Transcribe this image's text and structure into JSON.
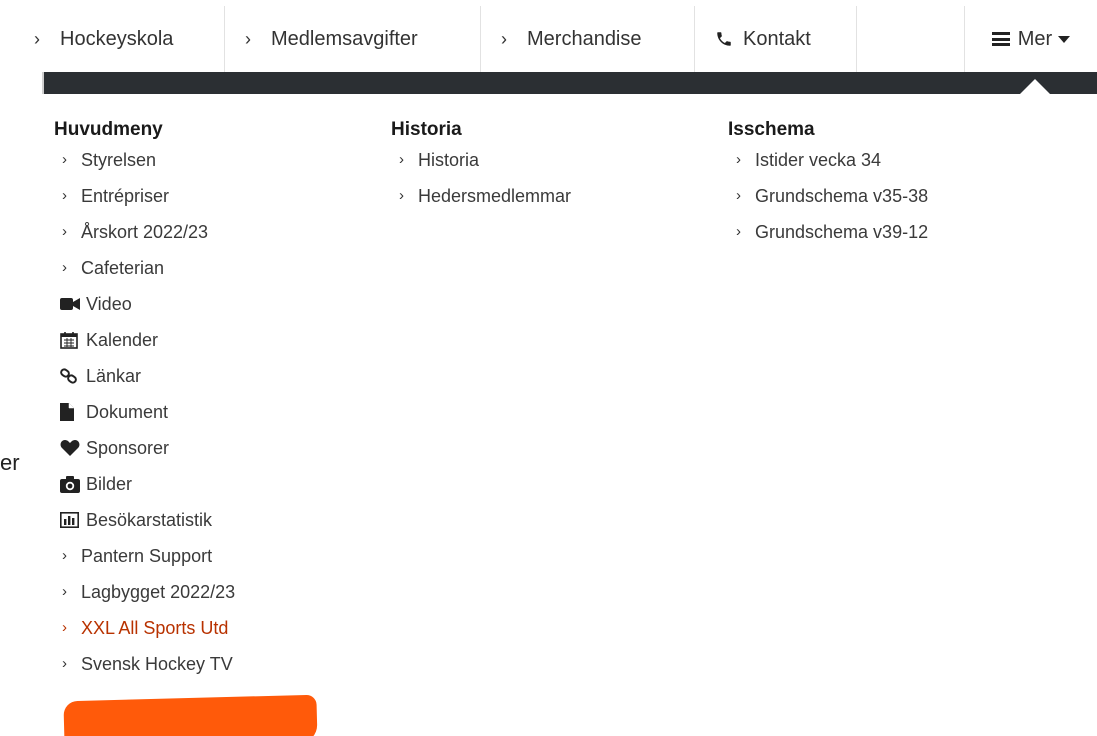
{
  "background": {
    "fragment_text": "er"
  },
  "topnav": {
    "items": [
      {
        "label": "Hockeyskola",
        "icon": "chevron-right-icon"
      },
      {
        "label": "Medlemsavgifter",
        "icon": "chevron-right-icon"
      },
      {
        "label": "Merchandise",
        "icon": "chevron-right-icon"
      },
      {
        "label": "Kontakt",
        "icon": "phone-icon"
      }
    ],
    "more": {
      "label": "Mer",
      "icon": "hamburger-icon",
      "caret": "caret-down-icon"
    }
  },
  "colors": {
    "highlight": "#ff5a0a",
    "band": "#2b2f33",
    "text": "#3a3a3a"
  },
  "mega_menu": {
    "columns": [
      {
        "title": "Huvudmeny",
        "items": [
          {
            "label": "Styrelsen",
            "icon": "chevron-right-icon"
          },
          {
            "label": "Entrépriser",
            "icon": "chevron-right-icon"
          },
          {
            "label": "Årskort 2022/23",
            "icon": "chevron-right-icon"
          },
          {
            "label": "Cafeterian",
            "icon": "chevron-right-icon"
          },
          {
            "label": "Video",
            "icon": "video-camera-icon"
          },
          {
            "label": "Kalender",
            "icon": "calendar-icon"
          },
          {
            "label": "Länkar",
            "icon": "link-icon"
          },
          {
            "label": "Dokument",
            "icon": "document-icon"
          },
          {
            "label": "Sponsorer",
            "icon": "heart-icon"
          },
          {
            "label": "Bilder",
            "icon": "camera-icon"
          },
          {
            "label": "Besökarstatistik",
            "icon": "bar-chart-icon"
          },
          {
            "label": "Pantern Support",
            "icon": "chevron-right-icon"
          },
          {
            "label": "Lagbygget 2022/23",
            "icon": "chevron-right-icon"
          },
          {
            "label": "XXL All Sports Utd",
            "icon": "chevron-right-icon",
            "highlighted": true
          },
          {
            "label": "Svensk Hockey TV",
            "icon": "chevron-right-icon"
          }
        ]
      },
      {
        "title": "Historia",
        "items": [
          {
            "label": "Historia",
            "icon": "chevron-right-icon"
          },
          {
            "label": "Hedersmedlemmar",
            "icon": "chevron-right-icon"
          }
        ]
      },
      {
        "title": "Isschema",
        "items": [
          {
            "label": "Istider vecka 34",
            "icon": "chevron-right-icon"
          },
          {
            "label": "Grundschema v35-38",
            "icon": "chevron-right-icon"
          },
          {
            "label": "Grundschema v39-12",
            "icon": "chevron-right-icon"
          }
        ]
      }
    ]
  }
}
